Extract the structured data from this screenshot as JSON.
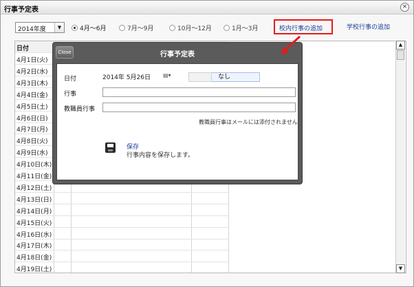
{
  "window": {
    "title": "行事予定表",
    "close_glyph": "×"
  },
  "toolbar": {
    "year_value": "2014年度",
    "year_arrow": "▼",
    "periods": [
      {
        "label": "4月〜6月",
        "selected": true
      },
      {
        "label": "7月〜9月",
        "selected": false
      },
      {
        "label": "10月〜12月",
        "selected": false
      },
      {
        "label": "1月〜3月",
        "selected": false
      }
    ],
    "school_event_add": "校内行事の追加",
    "school_event_add2": "学校行事の追加"
  },
  "table": {
    "header_date": "日付",
    "dates": [
      "4月1日(火)",
      "4月2日(水)",
      "4月3日(木)",
      "4月4日(金)",
      "4月5日(土)",
      "4月6日(日)",
      "4月7日(月)",
      "4月8日(火)",
      "4月9日(水)",
      "4月10日(木)",
      "4月11日(金)",
      "4月12日(土)",
      "4月13日(日)",
      "4月14日(月)",
      "4月15日(火)",
      "4月16日(水)",
      "4月17日(木)",
      "4月18日(金)",
      "4月19日(土)"
    ]
  },
  "dialog": {
    "close_label": "Close",
    "title": "行事予定表",
    "date_label": "日付",
    "date_value": "2014年 5月26日",
    "calendar_icon": "▤▾",
    "none_label": "なし",
    "event_label": "行事",
    "staff_event_label": "教職員行事",
    "note": "教職員行事はメールには添付されません",
    "save_link": "保存",
    "save_desc": "行事内容を保存します。"
  },
  "scroll": {
    "up": "▲",
    "down": "▼"
  },
  "colors": {
    "highlight_red": "#e31b1b",
    "link_blue": "#1c3f9c",
    "dialog_frame": "#5b5b5b"
  }
}
